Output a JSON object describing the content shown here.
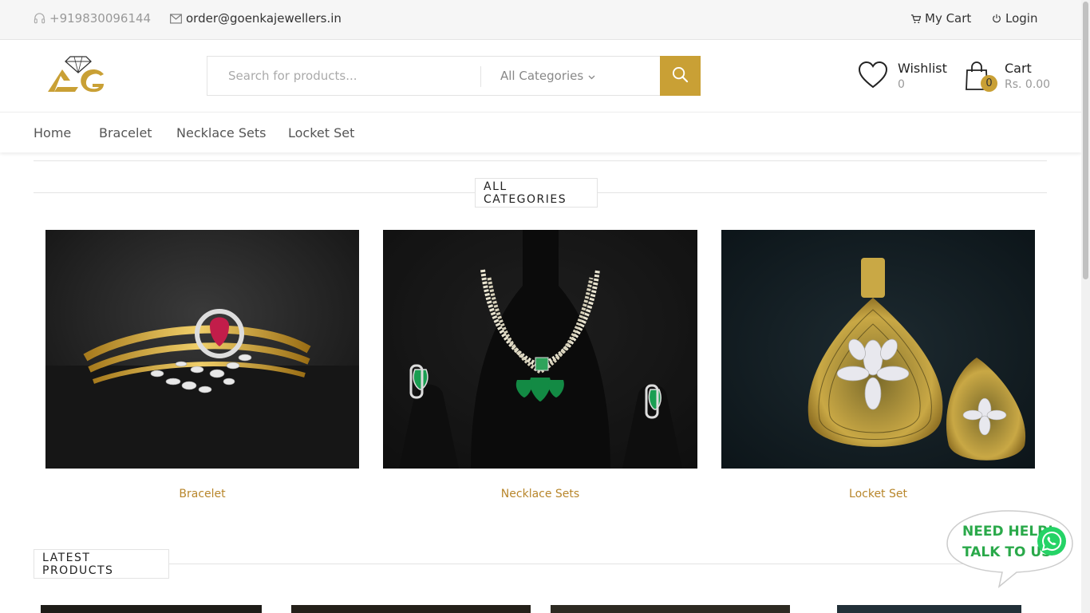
{
  "topbar": {
    "phone": "+919830096144",
    "email": "order@goenkajewellers.in",
    "my_cart": "My Cart",
    "login": "Login"
  },
  "header": {
    "logo_text": "AG",
    "search": {
      "placeholder": "Search for products...",
      "category": "All Categories"
    },
    "wishlist": {
      "label": "Wishlist",
      "count": "0"
    },
    "cart": {
      "label": "Cart",
      "total": "Rs. 0.00",
      "count": "0"
    }
  },
  "nav": {
    "items": [
      {
        "label": "Home"
      },
      {
        "label": "Bracelet"
      },
      {
        "label": "Necklace Sets"
      },
      {
        "label": "Locket Set"
      }
    ]
  },
  "categories": {
    "title": "ALL CATEGORIES",
    "items": [
      {
        "label": "Bracelet"
      },
      {
        "label": "Necklace Sets"
      },
      {
        "label": "Locket Set"
      }
    ]
  },
  "latest": {
    "title": "LATEST PRODUCTS"
  },
  "whatsapp": {
    "line1": "NEED HELP!",
    "line2": "TALK TO US"
  },
  "colors": {
    "accent": "#c9a035",
    "link": "#b8862b",
    "whatsapp": "#25d366"
  }
}
